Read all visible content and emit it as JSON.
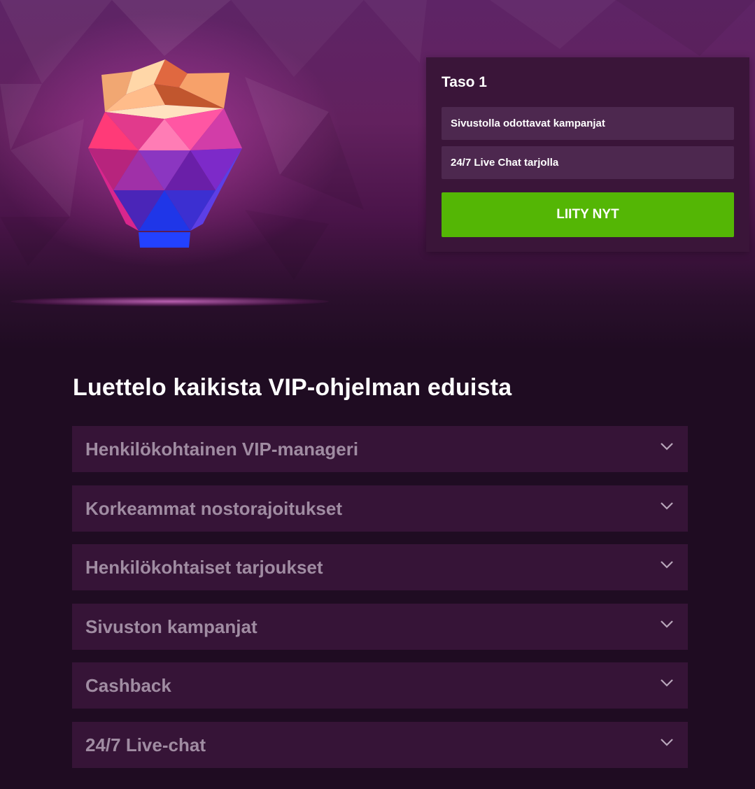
{
  "level_card": {
    "title": "Taso 1",
    "perks": [
      "Sivustolla odottavat kampanjat",
      "24/7 Live Chat tarjolla"
    ],
    "join_label": "LIITY NYT"
  },
  "benefits": {
    "title": "Luettelo kaikista VIP-ohjelman eduista",
    "items": [
      "Henkilökohtainen VIP-manageri",
      "Korkeammat nostorajoitukset",
      "Henkilökohtaiset tarjoukset",
      "Sivuston kampanjat",
      "Cashback",
      "24/7 Live-chat"
    ]
  },
  "icons": {
    "vip_gem": "crowned-gem-icon",
    "expand": "chevron-down-icon"
  },
  "colors": {
    "background": "#1f0c22",
    "card": "#3a1539",
    "perk": "#4d284f",
    "accent_green": "#54b605",
    "accordion": "#361437",
    "accordion_text": "#a08ca2"
  }
}
